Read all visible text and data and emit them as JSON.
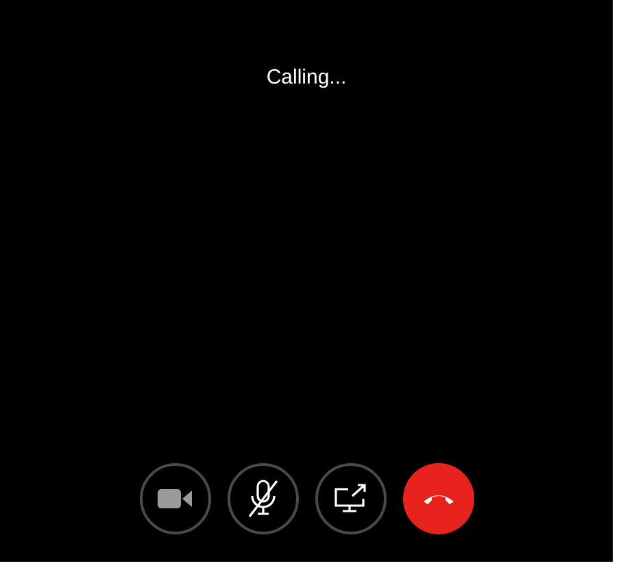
{
  "status": "Calling...",
  "controls": [
    {
      "kind": "video",
      "on": false
    },
    {
      "kind": "mic",
      "muted": true
    },
    {
      "kind": "share"
    },
    {
      "kind": "hangup"
    }
  ]
}
